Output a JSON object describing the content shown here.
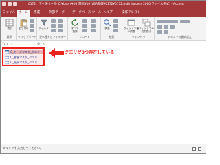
{
  "window": {
    "title": "0172：データベース- C:¥Users¥16_簡易¥16_VBA基礎¥0172¥0172.mdb (Access 2000 ファイル形式) - Access"
  },
  "ribbon_tabs": [
    "ファイル",
    "ホーム",
    "作成",
    "外部データ",
    "データベース ツール",
    "ヘルプ",
    "操作アシスト"
  ],
  "ribbon_groups": {
    "view": "表示",
    "clipboard": "クリップボード",
    "sort_filter": "並べ替えとフィルター",
    "records": "レコード",
    "find": "検索",
    "window": "ウィンドウ",
    "text_format": "テキストの書式設定"
  },
  "ribbon_buttons": {
    "view": "表示",
    "paste": "貼り付け",
    "filter": "フィルター",
    "refresh": "すべて\n更新",
    "find": "検索",
    "window_size": "ウィンドウ幅\nの調整",
    "switch_window": "ウィンドウの\n切り替え"
  },
  "nav_pane": {
    "title": "クエリ",
    "items": [
      {
        "label": "Q_ガーズマスタ_クエリ"
      },
      {
        "label": "Q_顧客マスタ_クエリ"
      },
      {
        "label": "Q_社員マスタ_クエリ"
      }
    ]
  },
  "annotation": {
    "text": "クエリが3つ存在している",
    "color": "#e8231d"
  },
  "status_bar": {
    "text": "コマンドを入力してください。"
  },
  "colors": {
    "accent": "#a4373a",
    "highlight": "#e8231d"
  }
}
